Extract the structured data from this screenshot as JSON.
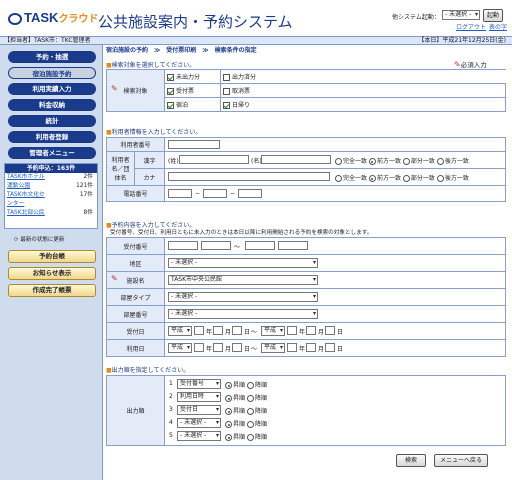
{
  "header": {
    "brand": "TASK",
    "brand_sub": "クラウド",
    "title": "公共施設案内・予約システム",
    "launch_label": "他システム起動：",
    "launch_select": "- 未選択 -",
    "launch_button": "起動",
    "logout": "ログアウト",
    "help": "表の字"
  },
  "bar": {
    "left": "【担当者】TASK市：TKC管理者",
    "right": "【本日】平成21年12月25日(金)"
  },
  "sidebar": {
    "items": [
      "予約・抽選",
      "宿泊施設予約",
      "利用実績入力",
      "料金収納",
      "統計",
      "利用者登録",
      "管理者メニュー"
    ],
    "status_title": "予約申込：163件",
    "status_rows": [
      {
        "name": "TASK市ホテル",
        "count": "2件"
      },
      {
        "name": "運動公園",
        "count": "121件"
      },
      {
        "name": "TASK市文化セ",
        "count": "17件"
      },
      {
        "name": "ンター",
        "count": ""
      },
      {
        "name": "TASK北部公民",
        "count": "8件"
      }
    ],
    "refresh": "最新の状態に更新",
    "actions": [
      "予約台帳",
      "お知らせ表示",
      "作成完了帳票"
    ]
  },
  "main": {
    "crumb": "宿泊施設の予約　≫　受付票印刷　≫　検索条件の指定",
    "s1": "検索対象を選択してください。",
    "required": "必須入力",
    "s1_label": "検索対象",
    "s1_opts": [
      {
        "label": "未出力分",
        "on": true
      },
      {
        "label": "出力済分",
        "on": false
      },
      {
        "label": "受付票",
        "on": true
      },
      {
        "label": "取消票",
        "on": false
      },
      {
        "label": "宿泊",
        "on": true
      },
      {
        "label": "日帰り",
        "on": true
      }
    ],
    "s2": "利用者情報を入力してください。",
    "s2_num": "利用者番号",
    "s2_name": "利用者名／団体名",
    "kanji": "漢字",
    "kana": "カナ",
    "sei": "(姓)",
    "mei": "(名)",
    "phone": "電話番号",
    "match": [
      "完全一致",
      "前方一致",
      "部分一致",
      "後方一致"
    ],
    "s3": "予約内容を入力してください。",
    "s3_note": "受付番号、受付日、利用日ともに未入力のときは本日以降に利用開始される予約を検索の対象とします。",
    "s3_rows": [
      "受付番号",
      "地区",
      "施設名",
      "部屋タイプ",
      "部屋番号",
      "受付日",
      "利用日"
    ],
    "s3_values": [
      "- 未選択 -",
      "TASK市中央公民館",
      "- 未選択 -",
      "- 未選択 -"
    ],
    "era": "平成",
    "y": "年",
    "m": "月",
    "d": "日",
    "dash": "〜",
    "s4": "出力順を指定してください。",
    "s4_label": "出力順",
    "s4_rows": [
      {
        "n": "1",
        "v": "受付番号"
      },
      {
        "n": "2",
        "v": "利用日時"
      },
      {
        "n": "3",
        "v": "受付日"
      },
      {
        "n": "4",
        "v": "- 未選択 -"
      },
      {
        "n": "5",
        "v": "- 未選択 -"
      }
    ],
    "asc": "昇順",
    "desc": "降順",
    "search": "検索",
    "back": "メニューへ戻る"
  }
}
